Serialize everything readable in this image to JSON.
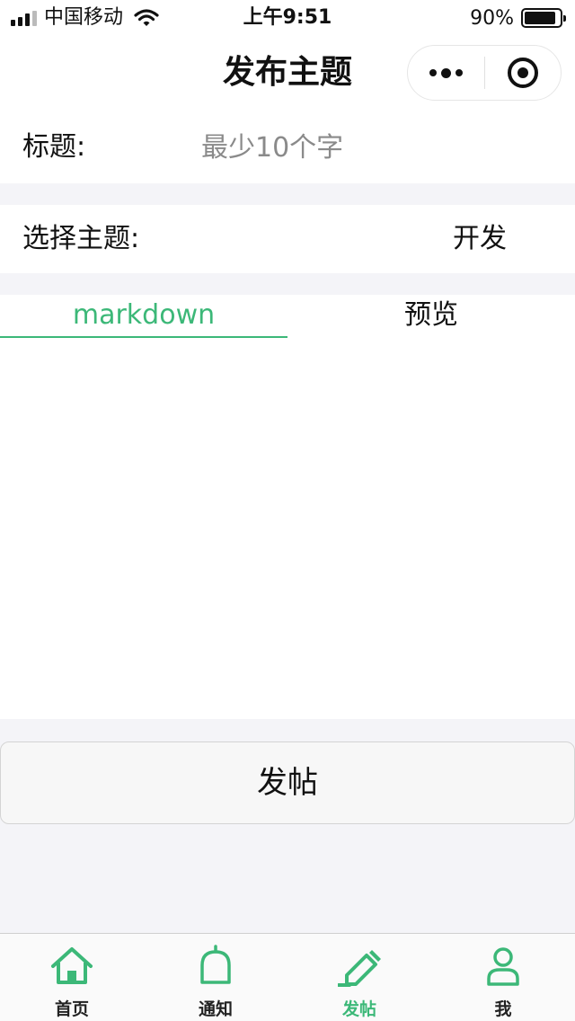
{
  "status_bar": {
    "carrier": "中国移动",
    "time": "上午9:51",
    "battery": "90%",
    "battery_level": 0.9
  },
  "header": {
    "title": "发布主题",
    "capsule_icons": [
      "more-dots-icon",
      "target-close-icon"
    ]
  },
  "form": {
    "title_label": "标题:",
    "title_placeholder": "最少10个字",
    "title_value": "",
    "topic_label": "选择主题:",
    "topic_value": "开发"
  },
  "editor": {
    "tabs": [
      {
        "label": "markdown",
        "active": true
      },
      {
        "label": "预览",
        "active": false
      }
    ],
    "content": ""
  },
  "submit_label": "发帖",
  "tab_bar": {
    "items": [
      {
        "label": "首页",
        "icon": "home-icon",
        "active": false
      },
      {
        "label": "通知",
        "icon": "bell-icon",
        "active": false
      },
      {
        "label": "发帖",
        "icon": "pencil-icon",
        "active": true
      },
      {
        "label": "我",
        "icon": "user-icon",
        "active": false
      }
    ]
  },
  "colors": {
    "accent": "#3cb878",
    "background": "#f4f4f8",
    "surface": "#ffffff"
  }
}
